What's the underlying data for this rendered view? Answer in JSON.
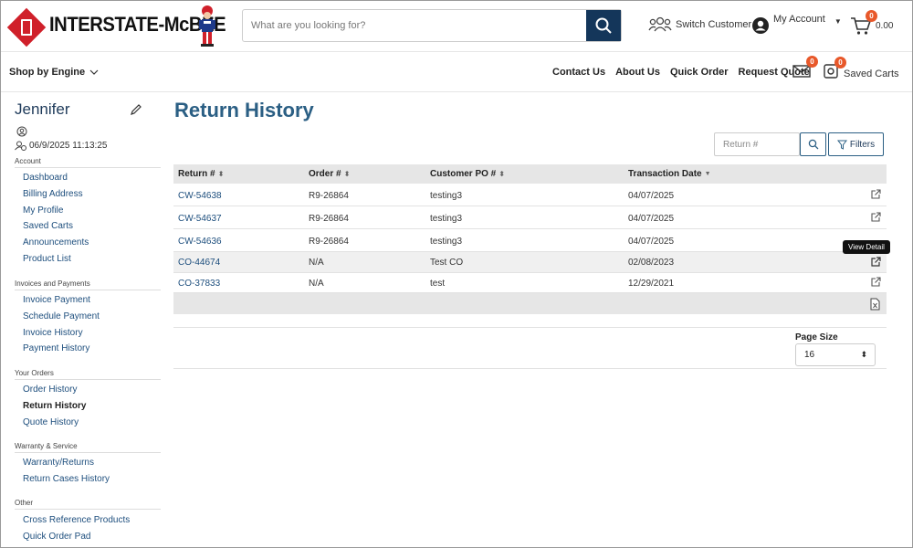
{
  "header": {
    "brand": "INTERSTATE-McBEE",
    "search_placeholder": "What are you looking for?",
    "switch_customer": "Switch Customer",
    "my_account": "My Account",
    "cart_count": "0",
    "cart_total": "0.00"
  },
  "nav": {
    "shop_by_engine": "Shop by Engine",
    "links": [
      "Contact Us",
      "About Us",
      "Quick Order",
      "Request Quote"
    ],
    "messages_count": "0",
    "saved_carts_count": "0",
    "saved_carts": "Saved Carts"
  },
  "sidebar": {
    "user": "Jennifer",
    "timestamp": "06/9/2025 11:13:25",
    "sections": [
      {
        "title": "Account",
        "items": [
          "Dashboard",
          "Billing Address",
          "My Profile",
          "Saved Carts",
          "Announcements",
          "Product List"
        ]
      },
      {
        "title": "Invoices and Payments",
        "items": [
          "Invoice Payment",
          "Schedule Payment",
          "Invoice History",
          "Payment History"
        ]
      },
      {
        "title": "Your Orders",
        "items": [
          "Order History",
          "Return History",
          "Quote History"
        ]
      },
      {
        "title": "Warranty & Service",
        "items": [
          "Warranty/Returns",
          "Return Cases History"
        ]
      },
      {
        "title": "Other",
        "items": [
          "Cross Reference Products",
          "Quick Order Pad"
        ]
      }
    ]
  },
  "main": {
    "title": "Return History",
    "return_placeholder": "Return #",
    "filters_label": "Filters",
    "columns": [
      "Return #",
      "Order #",
      "Customer PO #",
      "Transaction Date"
    ],
    "rows": [
      {
        "ret": "CW-54638",
        "order": "R9-26864",
        "po": "testing3",
        "date": "04/07/2025"
      },
      {
        "ret": "CW-54637",
        "order": "R9-26864",
        "po": "testing3",
        "date": "04/07/2025"
      },
      {
        "ret": "CW-54636",
        "order": "R9-26864",
        "po": "testing3",
        "date": "04/07/2025"
      },
      {
        "ret": "CO-44674",
        "order": "N/A",
        "po": "Test CO",
        "date": "02/08/2023"
      },
      {
        "ret": "CO-37833",
        "order": "N/A",
        "po": "test",
        "date": "12/29/2021"
      }
    ],
    "tooltip": "View Detail",
    "page_size_label": "Page Size",
    "page_size_value": "16"
  }
}
